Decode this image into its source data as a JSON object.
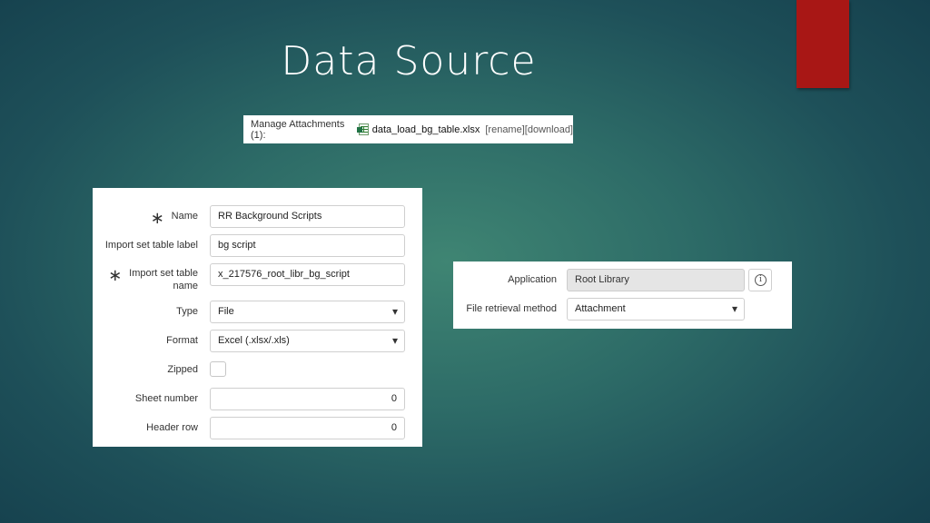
{
  "title": "Data Source",
  "attachments": {
    "label": "Manage Attachments (1):",
    "file_name": "data_load_bg_table.xlsx",
    "rename": "[rename]",
    "download": "[download]"
  },
  "form": {
    "name_label": "Name",
    "name_value": "RR Background Scripts",
    "import_label_label": "Import set table label",
    "import_label_value": "bg script",
    "import_name_label_line1": "Import set table",
    "import_name_label_line2": "name",
    "import_name_value": "x_217576_root_libr_bg_script",
    "type_label": "Type",
    "type_value": "File",
    "format_label": "Format",
    "format_value": "Excel (.xlsx/.xls)",
    "zipped_label": "Zipped",
    "sheet_label": "Sheet number",
    "sheet_value": "0",
    "header_label": "Header row",
    "header_value": "0"
  },
  "app_panel": {
    "application_label": "Application",
    "application_value": "Root Library",
    "retrieval_label": "File retrieval method",
    "retrieval_value": "Attachment"
  },
  "colors": {
    "accent_tab": "#a81715"
  },
  "icons": {
    "file": "excel-file-icon",
    "info": "info-icon",
    "dropdown": "chevron-down-icon",
    "required": "required-asterisk-icon"
  }
}
